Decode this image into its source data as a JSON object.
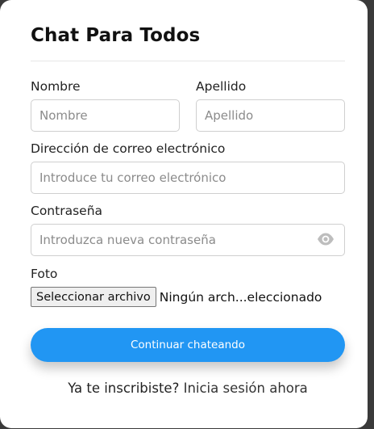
{
  "form": {
    "title": "Chat Para Todos",
    "first_name": {
      "label": "Nombre",
      "placeholder": "Nombre",
      "value": ""
    },
    "last_name": {
      "label": "Apellido",
      "placeholder": "Apellido",
      "value": ""
    },
    "email": {
      "label": "Dirección de correo electrónico",
      "placeholder": "Introduce tu correo electrónico",
      "value": ""
    },
    "password": {
      "label": "Contraseña",
      "placeholder": "Introduzca nueva contraseña",
      "value": "",
      "toggle_icon": "eye-icon"
    },
    "photo": {
      "label": "Foto",
      "button_label": "Seleccionar archivo",
      "status": "Ningún arch...eleccionado"
    },
    "submit_label": "Continuar chateando",
    "footer": {
      "text": "Ya te inscribiste?",
      "link": "Inicia sesión ahora"
    }
  },
  "colors": {
    "accent": "#2196f3",
    "background": "#3a3a3a",
    "card": "#ffffff"
  }
}
